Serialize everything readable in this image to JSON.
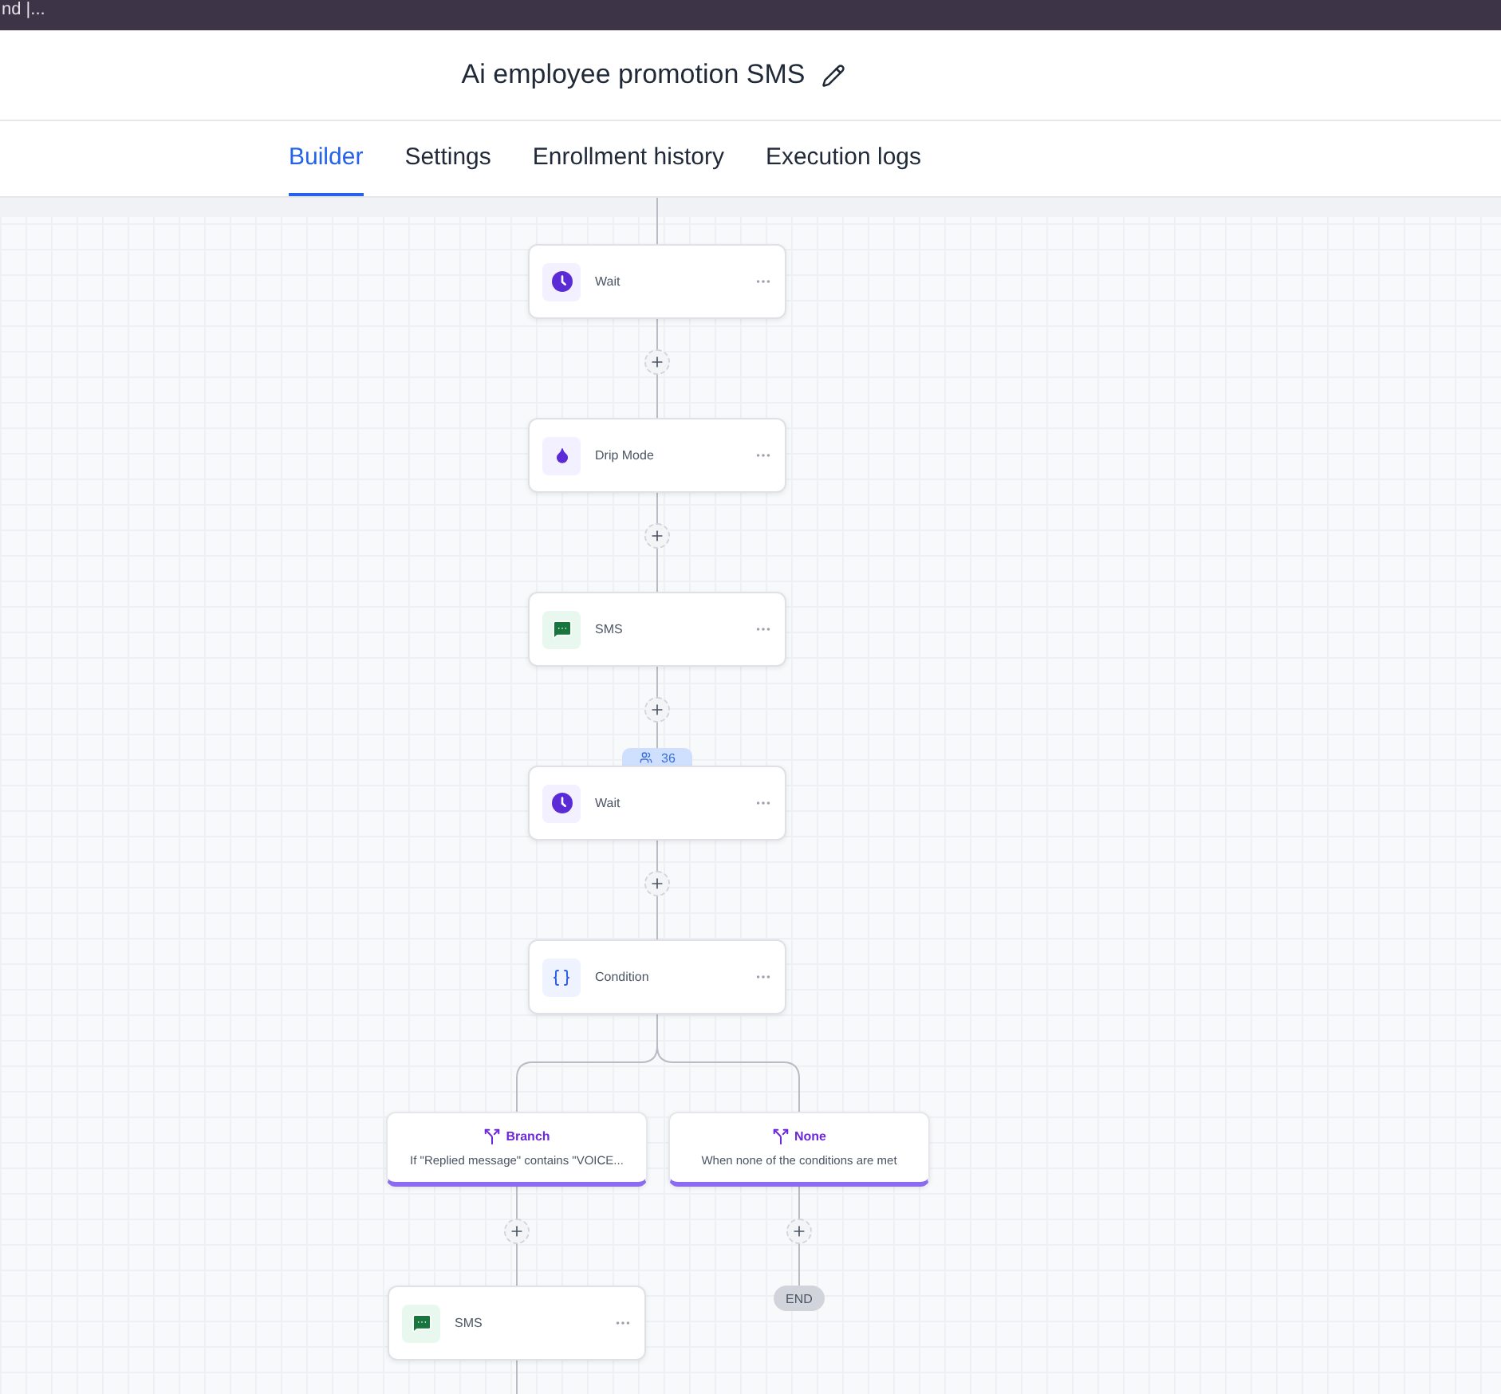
{
  "top_bar": {
    "text": "nd |..."
  },
  "header": {
    "title": "Ai employee promotion SMS"
  },
  "tabs": [
    {
      "label": "Builder",
      "selected": true
    },
    {
      "label": "Settings",
      "selected": false
    },
    {
      "label": "Enrollment history",
      "selected": false
    },
    {
      "label": "Execution logs",
      "selected": false
    }
  ],
  "flow": {
    "steps": [
      {
        "kind": "wait",
        "label": "Wait"
      },
      {
        "kind": "drip",
        "label": "Drip Mode"
      },
      {
        "kind": "sms",
        "label": "SMS"
      },
      {
        "kind": "wait",
        "label": "Wait",
        "badge": "36"
      },
      {
        "kind": "condition",
        "label": "Condition"
      }
    ],
    "branches": [
      {
        "title": "Branch",
        "description": "If \"Replied message\" contains \"VOICE...",
        "steps": [
          {
            "kind": "sms",
            "label": "SMS"
          }
        ]
      },
      {
        "title": "None",
        "description": "When none of the conditions are met",
        "end": "END"
      }
    ]
  }
}
